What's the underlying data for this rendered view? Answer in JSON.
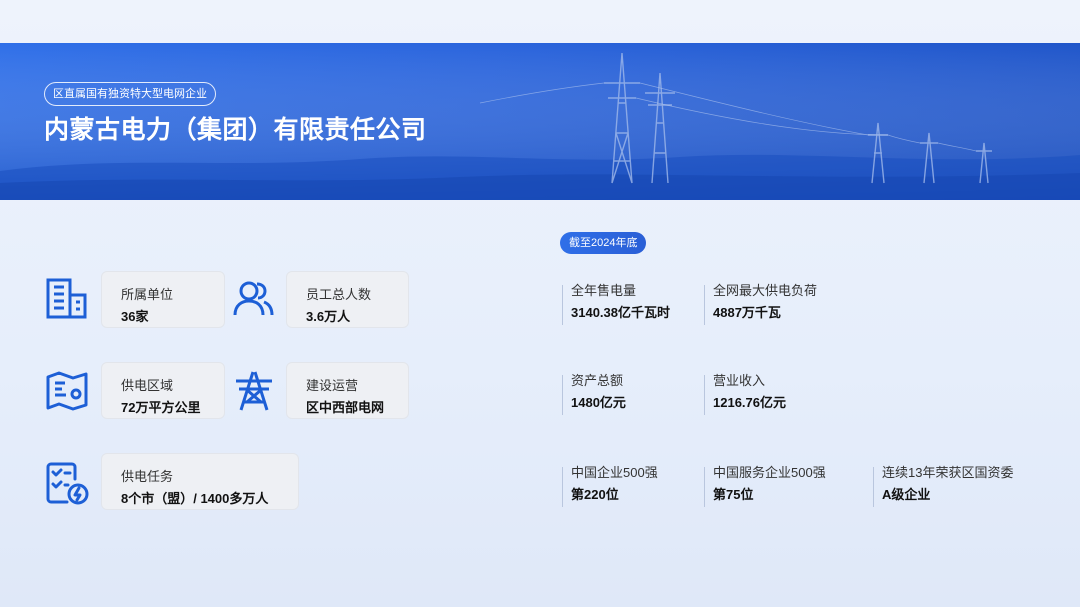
{
  "header": {
    "tagline": "区直属国有独资特大型电网企业",
    "company_name": "内蒙古电力（集团）有限责任公司"
  },
  "colors": {
    "accent": "#1d5fd6",
    "banner": "#2a64dc",
    "card_bg": "#eef0f4"
  },
  "info_cards": [
    {
      "icon": "building-icon",
      "label": "所属单位",
      "value": "36家"
    },
    {
      "icon": "people-icon",
      "label": "员工总人数",
      "value": "3.6万人"
    },
    {
      "icon": "map-icon",
      "label": "供电区域",
      "value": "72万平方公里"
    },
    {
      "icon": "power-tower-icon",
      "label": "建设运营",
      "value": "区中西部电网"
    },
    {
      "icon": "checklist-icon",
      "label": "供电任务",
      "value": "8个市（盟）/ 1400多万人"
    }
  ],
  "stats": {
    "as_of_badge": "截至2024年底",
    "items": [
      {
        "label": "全年售电量",
        "value": "3140.38亿千瓦时"
      },
      {
        "label": "全网最大供电负荷",
        "value": "4887万千瓦"
      },
      {
        "label": "资产总额",
        "value": "1480亿元"
      },
      {
        "label": "营业收入",
        "value": "1216.76亿元"
      },
      {
        "label": "中国企业500强",
        "value": "第220位"
      },
      {
        "label": "中国服务企业500强",
        "value": "第75位"
      },
      {
        "label": "连续13年荣获区国资委",
        "value": "A级企业"
      }
    ]
  }
}
